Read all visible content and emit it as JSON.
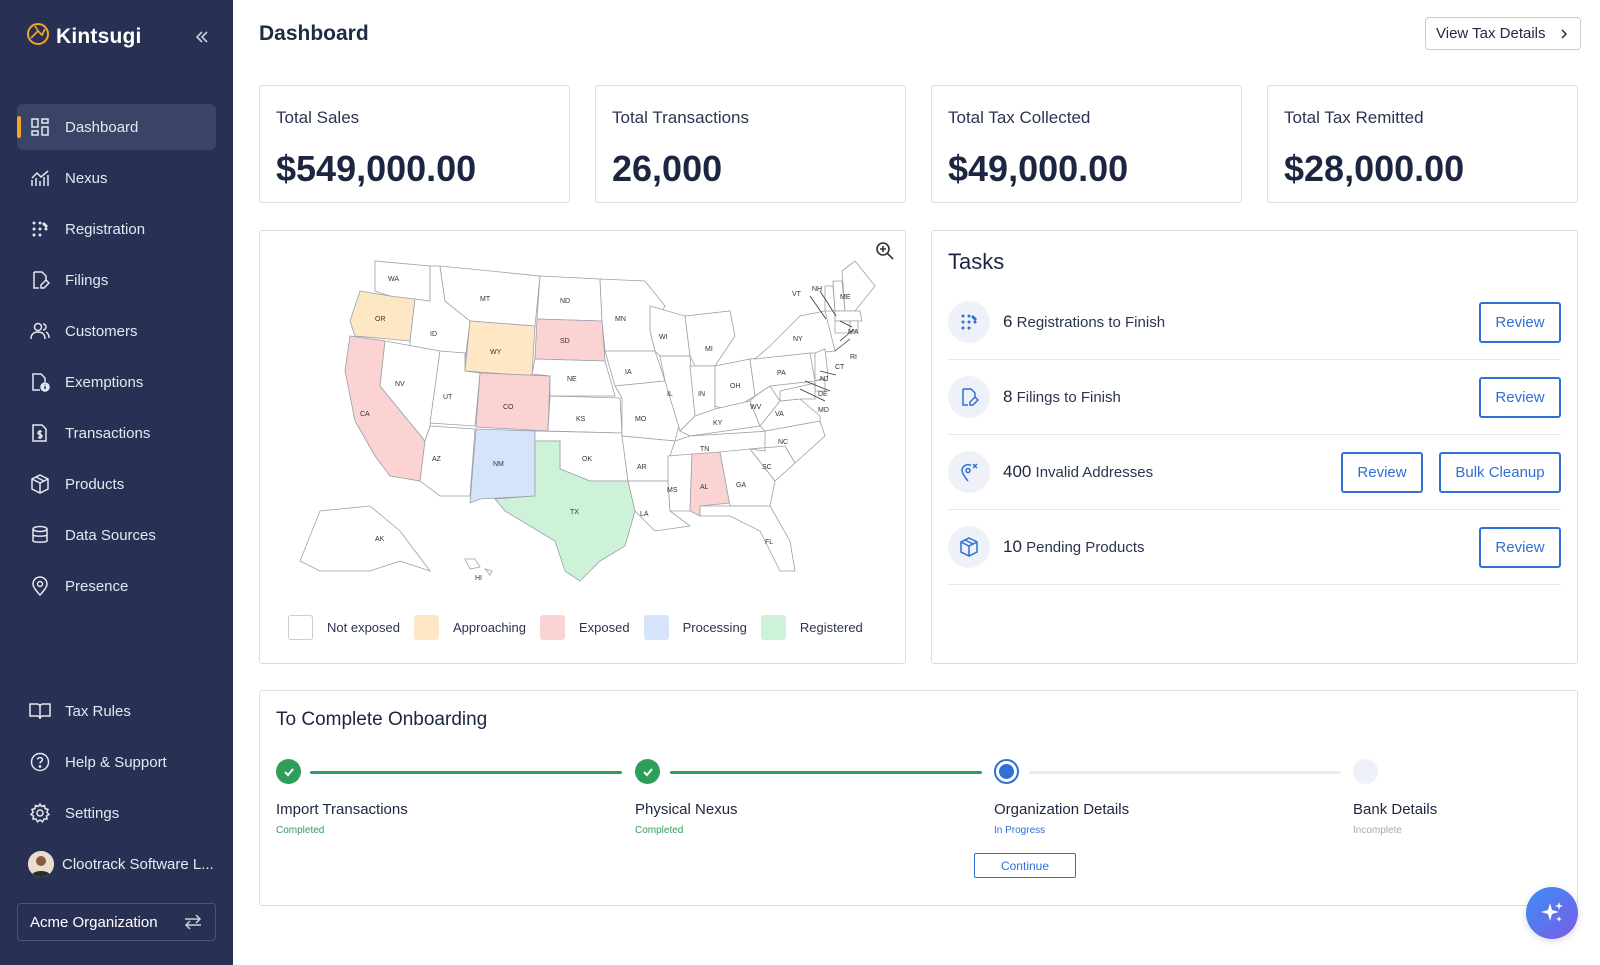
{
  "app": {
    "brand": "Kintsugi",
    "page_title": "Dashboard",
    "view_tax_details": "View Tax Details"
  },
  "sidebar": {
    "items": [
      {
        "label": "Dashboard",
        "icon": "dashboard-icon",
        "active": true
      },
      {
        "label": "Nexus",
        "icon": "chart-line-icon"
      },
      {
        "label": "Registration",
        "icon": "grid-dots-icon"
      },
      {
        "label": "Filings",
        "icon": "file-edit-icon"
      },
      {
        "label": "Customers",
        "icon": "users-icon"
      },
      {
        "label": "Exemptions",
        "icon": "file-info-icon"
      },
      {
        "label": "Transactions",
        "icon": "file-dollar-icon"
      },
      {
        "label": "Products",
        "icon": "cube-icon"
      },
      {
        "label": "Data Sources",
        "icon": "database-icon"
      },
      {
        "label": "Presence",
        "icon": "map-pin-icon"
      }
    ],
    "bottom_items": [
      {
        "label": "Tax Rules",
        "icon": "book-icon"
      },
      {
        "label": "Help & Support",
        "icon": "help-circle-icon"
      },
      {
        "label": "Settings",
        "icon": "gear-icon"
      }
    ],
    "user_name": "Clootrack Software L...",
    "organization": "Acme Organization"
  },
  "stats": [
    {
      "label": "Total Sales",
      "value": "$549,000.00"
    },
    {
      "label": "Total Transactions",
      "value": "26,000"
    },
    {
      "label": "Total Tax Collected",
      "value": "$49,000.00"
    },
    {
      "label": "Total Tax Remitted",
      "value": "$28,000.00"
    }
  ],
  "map": {
    "legend": [
      {
        "label": "Not exposed",
        "color": "#ffffff"
      },
      {
        "label": "Approaching",
        "color": "#fde7c4"
      },
      {
        "label": "Exposed",
        "color": "#fbd3d3"
      },
      {
        "label": "Processing",
        "color": "#d6e4fb"
      },
      {
        "label": "Registered",
        "color": "#cdf2d8"
      }
    ],
    "state_labels": {
      "WA": "WA",
      "OR": "OR",
      "CA": "CA",
      "ID": "ID",
      "NV": "NV",
      "MT": "MT",
      "WY": "WY",
      "UT": "UT",
      "CO": "CO",
      "AZ": "AZ",
      "NM": "NM",
      "ND": "ND",
      "SD": "SD",
      "NE": "NE",
      "KS": "KS",
      "OK": "OK",
      "TX": "TX",
      "MN": "MN",
      "IA": "IA",
      "MO": "MO",
      "AR": "AR",
      "LA": "LA",
      "WI": "WI",
      "IL": "IL",
      "MI": "MI",
      "IN": "IN",
      "OH": "OH",
      "KY": "KY",
      "TN": "TN",
      "MS": "MS",
      "AL": "AL",
      "GA": "GA",
      "FL": "FL",
      "SC": "SC",
      "NC": "NC",
      "VA": "VA",
      "WV": "WV",
      "PA": "PA",
      "NY": "NY",
      "VT": "VT",
      "NH": "NH",
      "ME": "ME",
      "MA": "MA",
      "RI": "RI",
      "CT": "CT",
      "NJ": "NJ",
      "DE": "DE",
      "MD": "MD",
      "AK": "AK",
      "HI": "HI"
    }
  },
  "tasks": {
    "title": "Tasks",
    "items": [
      {
        "count": "6",
        "text": "Registrations to Finish",
        "icon": "grid-dots-icon",
        "buttons": [
          "Review"
        ]
      },
      {
        "count": "8",
        "text": "Filings to Finish",
        "icon": "file-edit-icon",
        "buttons": [
          "Review"
        ]
      },
      {
        "count": "400",
        "text": "Invalid Addresses",
        "icon": "map-pin-x-icon",
        "buttons": [
          "Review",
          "Bulk Cleanup"
        ]
      },
      {
        "count": "10",
        "text": "Pending Products",
        "icon": "cube-icon",
        "buttons": [
          "Review"
        ]
      }
    ]
  },
  "onboarding": {
    "title": "To Complete Onboarding",
    "steps": [
      {
        "label": "Import Transactions",
        "status": "Completed"
      },
      {
        "label": "Physical Nexus",
        "status": "Completed"
      },
      {
        "label": "Organization Details",
        "status": "In Progress"
      },
      {
        "label": "Bank Details",
        "status": "Incomplete"
      }
    ],
    "continue_label": "Continue"
  },
  "colors": {
    "sidebar_bg": "#283153",
    "accent": "#2f6fd6",
    "active_marker": "#f5a524",
    "completed": "#2e9e5b",
    "in_progress": "#2f6fd6"
  }
}
